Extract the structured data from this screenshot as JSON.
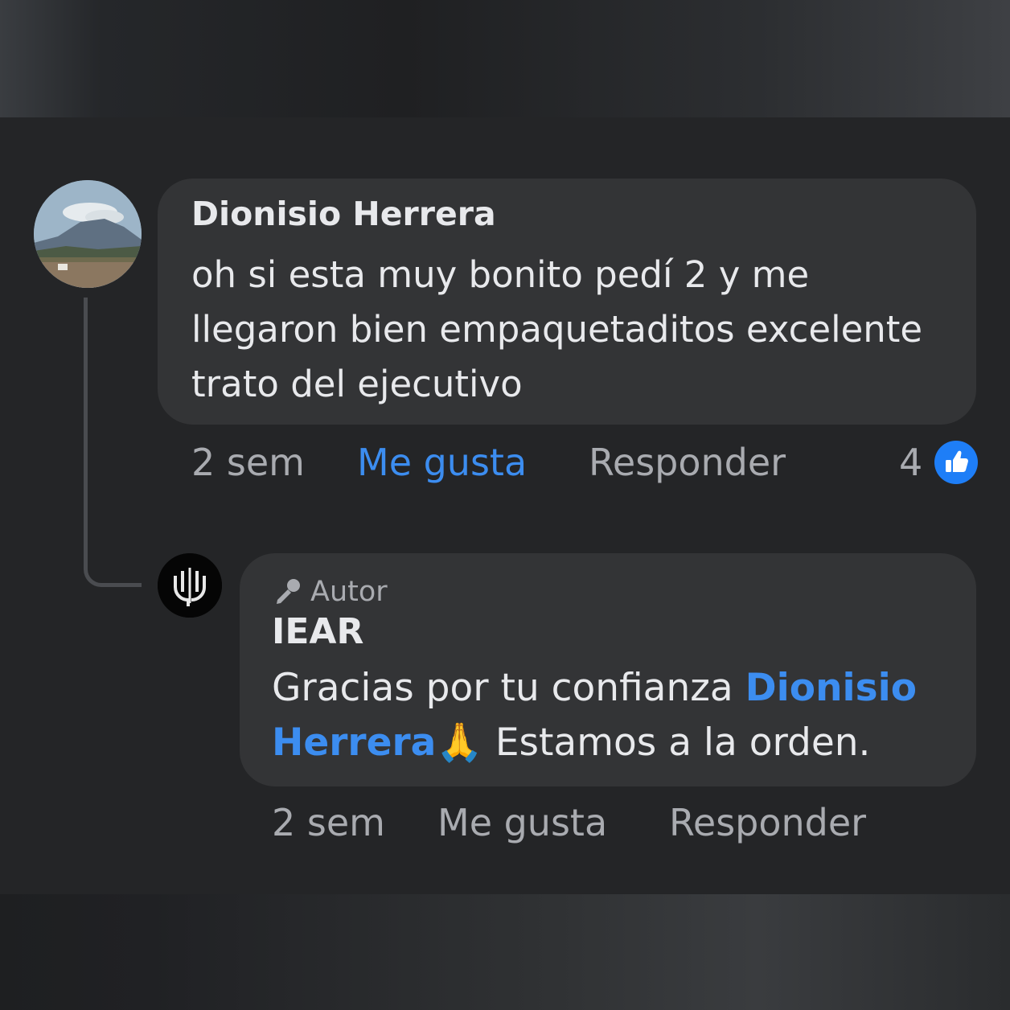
{
  "comment": {
    "author": "Dionisio Herrera",
    "text": "oh si esta muy bonito pedí 2 y me llegaron bien empaquetaditos excelente trato del ejecutivo",
    "time": "2 sem",
    "like_label": "Me gusta",
    "reply_label": "Responder",
    "reaction_count": "4",
    "reaction_icon": "thumbs-up-icon",
    "accent_color": "#3c8df0"
  },
  "reply": {
    "badge_label": "Autor",
    "badge_icon": "microphone-icon",
    "author": "IEAR",
    "text_before": "Gracias por tu confianza ",
    "mention": "Dionisio Herrera",
    "emoji": "🙏",
    "text_after": " Estamos a la orden.",
    "time": "2 sem",
    "like_label": "Me gusta",
    "reply_label": "Responder"
  }
}
